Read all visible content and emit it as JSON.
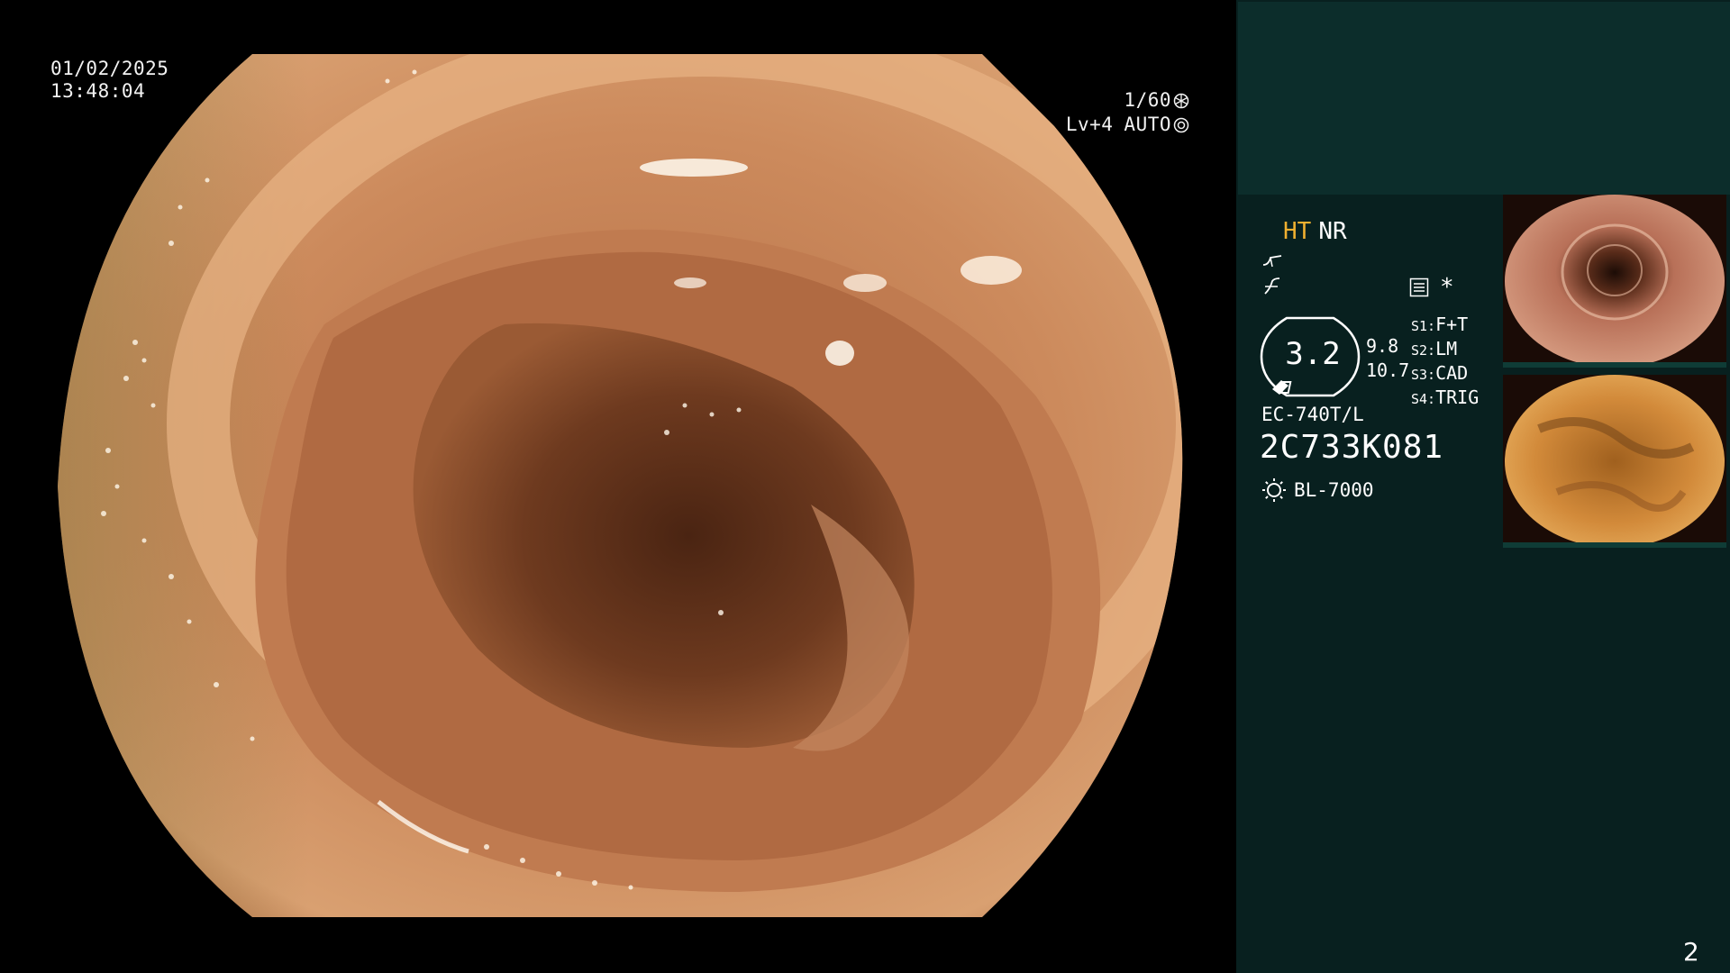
{
  "overlay": {
    "date": "01/02/2025",
    "time": "13:48:04",
    "shutter": "1/60",
    "level": "Lv+4",
    "iris_mode": "AUTO"
  },
  "panel": {
    "enhance_ht": "HT",
    "enhance_nr": "NR",
    "asterisk": "*",
    "zoom_value": "3.2",
    "zoom_n1": "9.8",
    "zoom_n2": "10.7",
    "switches": [
      {
        "key": "S1:",
        "value": "F+T"
      },
      {
        "key": "S2:",
        "value": "LM"
      },
      {
        "key": "S3:",
        "value": "CAD"
      },
      {
        "key": "S4:",
        "value": "TRIG"
      }
    ],
    "scope_model": "EC-740T/L",
    "scope_serial": "2C733K081",
    "light_source": "BL-7000"
  },
  "thumbnails": [
    {
      "icon": "colon-lumen-thumbnail"
    },
    {
      "icon": "colon-stool-thumbnail"
    }
  ],
  "page_number": "2",
  "colors": {
    "panel_bg": "#08201f",
    "panel_top": "#0c2d2b",
    "accent_ht": "#f0b030"
  }
}
